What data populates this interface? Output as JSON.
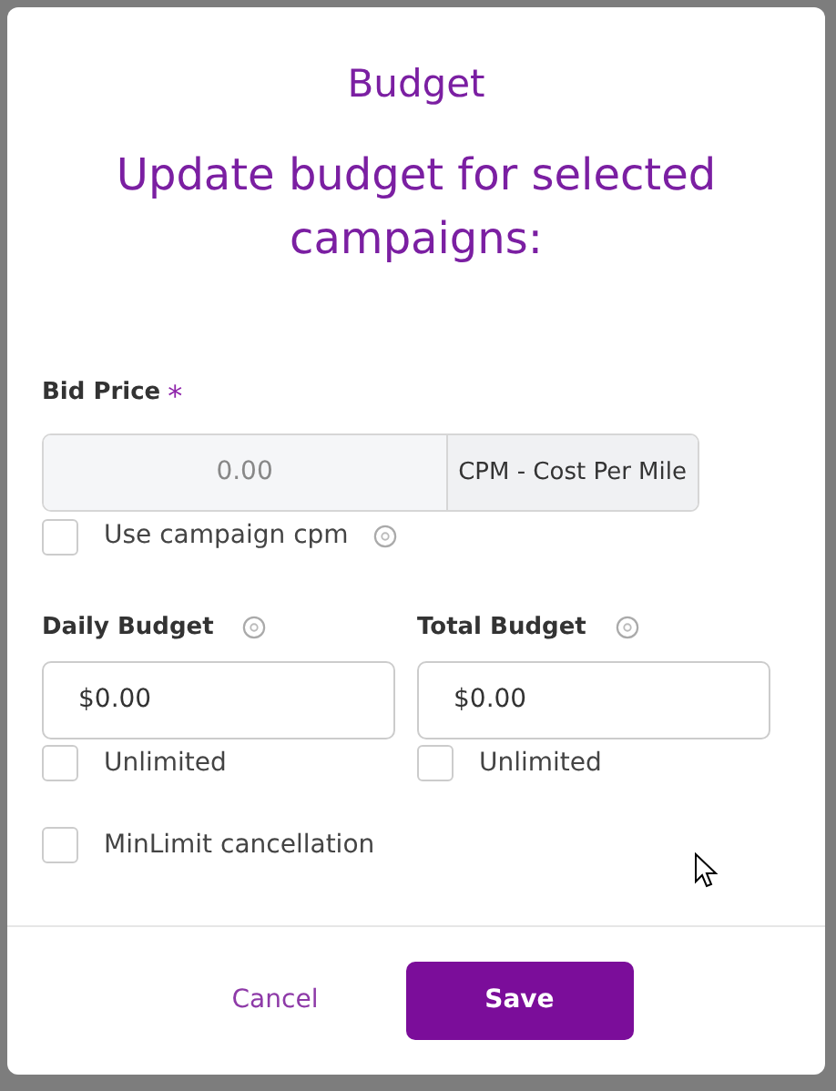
{
  "modal": {
    "title": "Budget",
    "subtitle": "Update budget for selected campaigns:"
  },
  "bid_price": {
    "label": "Bid Price",
    "required_mark": "*",
    "value": "0.00",
    "disabled": true,
    "addon": "CPM - Cost Per Mile",
    "option": {
      "label": "Use campaign cpm",
      "checked": false
    }
  },
  "budgets": [
    {
      "label": "Daily Budget",
      "value": "$0.00",
      "option": {
        "label": "Unlimited",
        "checked": false
      }
    },
    {
      "label": "Total Budget",
      "value": "$0.00",
      "option": {
        "label": "Unlimited",
        "checked": false
      }
    }
  ],
  "min_limit": {
    "label": "MinLimit cancellation",
    "checked": false
  },
  "buttons": [
    {
      "label": "Cancel",
      "kind": "link"
    },
    {
      "label": "Save",
      "kind": "primary"
    }
  ]
}
